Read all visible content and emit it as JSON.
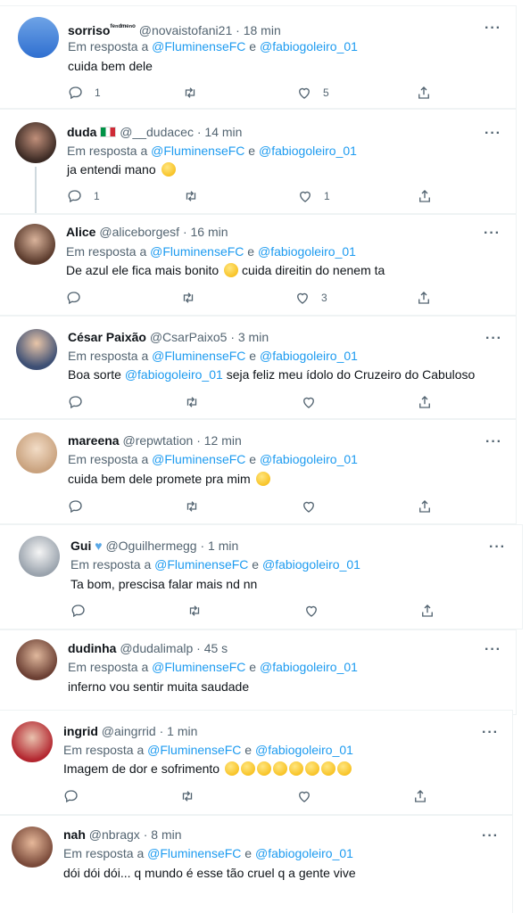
{
  "tweets": [
    {
      "name": "sorriso",
      "name_suffix": "ᶠᵉⁿᵈᵐᵉⁿᵒ",
      "handle": "@novaistofani21",
      "time": "18 min",
      "reply_prefix": "Em resposta a",
      "mention1": "@FluminenseFC",
      "and": "e",
      "mention2": "@fabiogoleiro_01",
      "text": "cuida bem dele",
      "replies": "1",
      "retweets": "",
      "likes": "5",
      "avatar_color": "#2f6fd0"
    },
    {
      "name": "duda",
      "handle": "@__dudacec",
      "time": "14 min",
      "reply_prefix": "Em resposta a",
      "mention1": "@FluminenseFC",
      "and": "e",
      "mention2": "@fabiogoleiro_01",
      "text": "ja entendi mano",
      "replies": "1",
      "retweets": "",
      "likes": "1",
      "avatar_color": "#3b2a24"
    },
    {
      "name": "Alice",
      "handle": "@aliceborgesf",
      "time": "16 min",
      "reply_prefix": "Em resposta a",
      "mention1": "@FluminenseFC",
      "and": "e",
      "mention2": "@fabiogoleiro_01",
      "text_a": "De azul ele fica mais bonito",
      "text_b": "cuida direitin do nenem ta",
      "replies": "",
      "retweets": "",
      "likes": "3",
      "avatar_color": "#5a3a2c"
    },
    {
      "name": "César Paixão",
      "handle": "@CsarPaixo5",
      "time": "3 min",
      "reply_prefix": "Em resposta a",
      "mention1": "@FluminenseFC",
      "and": "e",
      "mention2": "@fabiogoleiro_01",
      "text_a": "Boa sorte",
      "text_mention": "@fabiogoleiro_01",
      "text_b": "seja feliz meu ídolo do Cruzeiro do Cabuloso",
      "replies": "",
      "retweets": "",
      "likes": "",
      "avatar_color": "#3d4f74"
    },
    {
      "name": "mareena",
      "handle": "@repwtation",
      "time": "12 min",
      "reply_prefix": "Em resposta a",
      "mention1": "@FluminenseFC",
      "and": "e",
      "mention2": "@fabiogoleiro_01",
      "text": "cuida bem dele promete pra mim",
      "replies": "",
      "retweets": "",
      "likes": "",
      "avatar_color": "#c9a27e"
    },
    {
      "name": "Gui",
      "handle": "@Oguilhermegg",
      "time": "1 min",
      "reply_prefix": "Em resposta a",
      "mention1": "@FluminenseFC",
      "and": "e",
      "mention2": "@fabiogoleiro_01",
      "text": "Ta bom, prescisa falar mais nd nn",
      "replies": "",
      "retweets": "",
      "likes": "",
      "avatar_color": "#9aa3ad"
    },
    {
      "name": "dudinha",
      "handle": "@dudalimalp",
      "time": "45 s",
      "reply_prefix": "Em resposta a",
      "mention1": "@FluminenseFC",
      "and": "e",
      "mention2": "@fabiogoleiro_01",
      "text": "inferno vou sentir muita saudade",
      "replies": "",
      "retweets": "",
      "likes": "",
      "avatar_color": "#6b3f33"
    },
    {
      "name": "ingrid",
      "handle": "@aingrrid",
      "time": "1 min",
      "reply_prefix": "Em resposta a",
      "mention1": "@FluminenseFC",
      "and": "e",
      "mention2": "@fabiogoleiro_01",
      "text": "Imagem de dor e sofrimento",
      "replies": "",
      "retweets": "",
      "likes": "",
      "avatar_color": "#b3262f"
    },
    {
      "name": "nah",
      "handle": "@nbragx",
      "time": "8 min",
      "reply_prefix": "Em resposta a",
      "mention1": "@FluminenseFC",
      "and": "e",
      "mention2": "@fabiogoleiro_01",
      "text": "dói dói dói... q mundo é esse tão cruel q a gente vive",
      "replies": "",
      "retweets": "",
      "likes": "",
      "avatar_color": "#7a4a3a"
    }
  ],
  "dot": "·",
  "more_label": "···",
  "colors": {
    "link": "#1d9bf0",
    "muted": "#536471",
    "text": "#0f1419"
  }
}
